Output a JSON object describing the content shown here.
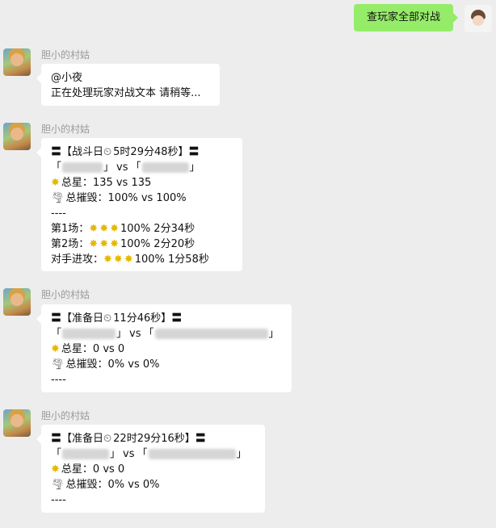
{
  "user": {
    "message": "查玩家全部对战"
  },
  "bot": {
    "name": "胆小的村姑"
  },
  "messages": [
    {
      "lines": [
        "@小夜",
        "正在处理玩家对战文本 请稍等..."
      ]
    },
    {
      "header_open": "〓【战斗日 ",
      "header_time": "5时29分48秒",
      "header_close": "】〓",
      "vs": "vs",
      "total_stars_label": "总星：",
      "total_stars": "135 vs 135",
      "destruction_label": "总摧毁：",
      "destruction": "100% vs 100%",
      "separator": "----",
      "rounds": [
        {
          "label": "第1场：",
          "result": "100% 2分34秒"
        },
        {
          "label": "第2场：",
          "result": "100% 2分20秒"
        },
        {
          "label": "对手进攻：",
          "result": "100% 1分58秒"
        }
      ]
    },
    {
      "header_open": "〓【准备日 ",
      "header_time": "11分46秒",
      "header_close": "】〓",
      "vs": "vs",
      "total_stars_label": "总星：",
      "total_stars": "0 vs 0",
      "destruction_label": "总摧毁：",
      "destruction": "0% vs 0%",
      "separator": "----"
    },
    {
      "header_open": "〓【准备日 ",
      "header_time": "22时29分16秒",
      "header_close": "】〓",
      "vs": "vs",
      "total_stars_label": "总星：",
      "total_stars": "0 vs 0",
      "destruction_label": "总摧毁：",
      "destruction": "0% vs 0%",
      "separator": "----"
    }
  ],
  "icons": {
    "star": "star-burst-icon",
    "tornado": "tornado-icon",
    "timer": "alarm-clock-icon"
  },
  "colors": {
    "background": "#ededed",
    "user_bubble": "#95ec69",
    "bot_bubble": "#ffffff"
  }
}
